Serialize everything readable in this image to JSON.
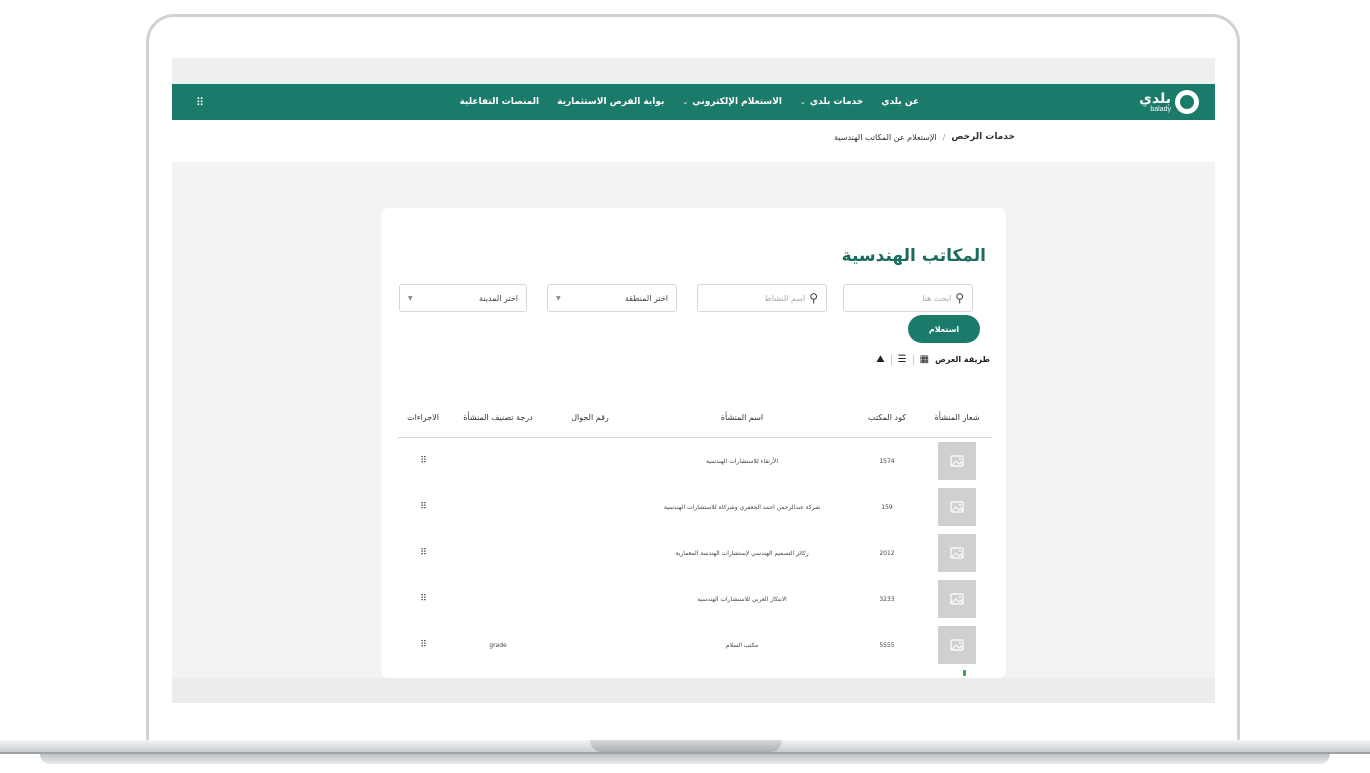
{
  "header": {
    "logo_ar": "بلدي",
    "logo_en": "balady",
    "nav": [
      {
        "label": "عن بلدي",
        "chevron": false
      },
      {
        "label": "خدمات بلدي",
        "chevron": true
      },
      {
        "label": "الاستعلام الإلكتروني",
        "chevron": true
      },
      {
        "label": "بوابة الفرص الاستثمارية",
        "chevron": false
      },
      {
        "label": "المنصات التفاعلية",
        "chevron": false
      }
    ],
    "apps_icon": "⠿"
  },
  "breadcrumb": {
    "root": "خدمات الرخص",
    "separator": "/",
    "current": "الإستعلام عن المكاتب الهندسية"
  },
  "page": {
    "title": "المكاتب الهندسية"
  },
  "filters": {
    "search_placeholder": "ابحث هنا",
    "activity_placeholder": "اسم النشاط",
    "region_label": "اختر المنطقة",
    "city_label": "اختر المدينة",
    "query_button": "استعلام"
  },
  "view_mode": {
    "label": "طريقة العرض"
  },
  "table": {
    "headers": {
      "logo": "شعار المنشأة",
      "code": "كود المكتب",
      "name": "اسم المنشأة",
      "phone": "رقم الجوال",
      "grade": "درجة تصنيف المنشأة",
      "actions": "الاجراءات"
    },
    "rows": [
      {
        "code": "1574",
        "name": "الأرتقاء للاستشارات الهندسية",
        "phone": "",
        "grade": ""
      },
      {
        "code": "159",
        "name": "شركة عبدالرحمن احمد الجعفري وشركاه للاستشارات الهندسية",
        "phone": "",
        "grade": ""
      },
      {
        "code": "2012",
        "name": "ركائز التصميم الهندسي لإستشارات الهندسة المعمارية",
        "phone": "",
        "grade": ""
      },
      {
        "code": "3233",
        "name": "الابتكار العربي للاستشارات الهندسية",
        "phone": "",
        "grade": ""
      },
      {
        "code": "5555",
        "name": "مكتب السلام",
        "phone": "",
        "grade": "grade"
      }
    ]
  },
  "colors": {
    "brand_green": "#1b7b6b",
    "title_green": "#1b6b5e"
  }
}
